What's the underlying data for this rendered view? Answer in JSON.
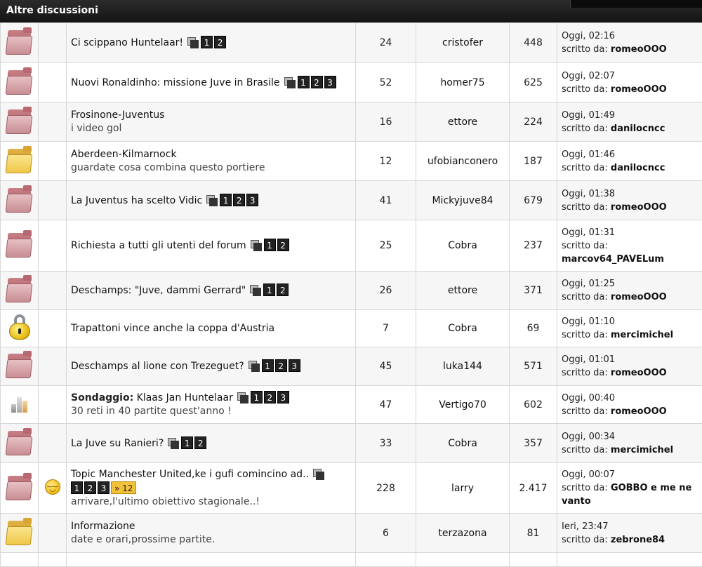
{
  "section": {
    "title": "Altre discussioni"
  },
  "labels": {
    "written_by": "scritto da:"
  },
  "colors": {
    "header_bg": "#1f1f1f",
    "hot_folder": "#c78e94",
    "new_folder": "#efc84a",
    "more_pages": "#f3c138"
  },
  "topics": [
    {
      "icon": "hot-folder-icon",
      "emoticon": "",
      "prefix": "",
      "title": "Ci scippano Huntelaar!",
      "subtitle": "",
      "pages": [
        "1",
        "2"
      ],
      "more": "",
      "replies": "24",
      "author": "cristofer",
      "views": "448",
      "last_time": "Oggi, 02:16",
      "last_user": "romeoOOO"
    },
    {
      "icon": "hot-folder-icon",
      "emoticon": "",
      "prefix": "",
      "title": "Nuovi Ronaldinho: missione Juve in Brasile",
      "subtitle": "",
      "pages": [
        "1",
        "2",
        "3"
      ],
      "more": "",
      "replies": "52",
      "author": "homer75",
      "views": "625",
      "last_time": "Oggi, 02:07",
      "last_user": "romeoOOO"
    },
    {
      "icon": "hot-folder-icon",
      "emoticon": "",
      "prefix": "",
      "title": "Frosinone-Juventus",
      "subtitle": "i video gol",
      "pages": [],
      "more": "",
      "replies": "16",
      "author": "ettore",
      "views": "224",
      "last_time": "Oggi, 01:49",
      "last_user": "danilocncc"
    },
    {
      "icon": "new-folder-icon",
      "emoticon": "",
      "prefix": "",
      "title": "Aberdeen-Kilmarnock",
      "subtitle": "guardate cosa combina questo portiere",
      "pages": [],
      "more": "",
      "replies": "12",
      "author": "ufobianconero",
      "views": "187",
      "last_time": "Oggi, 01:46",
      "last_user": "danilocncc"
    },
    {
      "icon": "hot-folder-icon",
      "emoticon": "",
      "prefix": "",
      "title": "La Juventus ha scelto Vidic",
      "subtitle": "",
      "pages": [
        "1",
        "2",
        "3"
      ],
      "more": "",
      "replies": "41",
      "author": "Mickyjuve84",
      "views": "679",
      "last_time": "Oggi, 01:38",
      "last_user": "romeoOOO"
    },
    {
      "icon": "hot-folder-icon",
      "emoticon": "",
      "prefix": "",
      "title": "Richiesta a tutti gli utenti del forum",
      "subtitle": "",
      "pages": [
        "1",
        "2"
      ],
      "more": "",
      "replies": "25",
      "author": "Cobra",
      "views": "237",
      "last_time": "Oggi, 01:31",
      "last_user": "marcov64_PAVELum"
    },
    {
      "icon": "hot-folder-icon",
      "emoticon": "",
      "prefix": "",
      "title": "Deschamps: \"Juve, dammi Gerrard\"",
      "subtitle": "",
      "pages": [
        "1",
        "2"
      ],
      "more": "",
      "replies": "26",
      "author": "ettore",
      "views": "371",
      "last_time": "Oggi, 01:25",
      "last_user": "romeoOOO"
    },
    {
      "icon": "lock-icon",
      "emoticon": "",
      "prefix": "",
      "title": "Trapattoni vince anche la coppa d'Austria",
      "subtitle": "",
      "pages": [],
      "more": "",
      "replies": "7",
      "author": "Cobra",
      "views": "69",
      "last_time": "Oggi, 01:10",
      "last_user": "mercimichel"
    },
    {
      "icon": "hot-folder-icon",
      "emoticon": "",
      "prefix": "",
      "title": "Deschamps al lione con Trezeguet?",
      "subtitle": "",
      "pages": [
        "1",
        "2",
        "3"
      ],
      "more": "",
      "replies": "45",
      "author": "luka144",
      "views": "571",
      "last_time": "Oggi, 01:01",
      "last_user": "romeoOOO"
    },
    {
      "icon": "poll-icon",
      "emoticon": "",
      "prefix": "Sondaggio:",
      "title": "Klaas Jan Huntelaar",
      "subtitle": "30 reti in 40 partite quest'anno !",
      "pages": [
        "1",
        "2",
        "3"
      ],
      "more": "",
      "replies": "47",
      "author": "Vertigo70",
      "views": "602",
      "last_time": "Oggi, 00:40",
      "last_user": "romeoOOO"
    },
    {
      "icon": "hot-folder-icon",
      "emoticon": "",
      "prefix": "",
      "title": "La Juve su Ranieri?",
      "subtitle": "",
      "pages": [
        "1",
        "2"
      ],
      "more": "",
      "replies": "33",
      "author": "Cobra",
      "views": "357",
      "last_time": "Oggi, 00:34",
      "last_user": "mercimichel"
    },
    {
      "icon": "hot-folder-icon",
      "emoticon": "smiley-icon",
      "prefix": "",
      "title": "Topic Manchester United,ke i gufi comincino ad..",
      "subtitle": "arrivare,l'ultimo obiettivo stagionale..!",
      "pages": [
        "1",
        "2",
        "3"
      ],
      "more": "» 12",
      "replies": "228",
      "author": "larry",
      "views": "2.417",
      "last_time": "Oggi, 00:07",
      "last_user": "GOBBO e me ne vanto"
    },
    {
      "icon": "new-folder-icon",
      "emoticon": "",
      "prefix": "",
      "title": "Informazione",
      "subtitle": "date e orari,prossime partite.",
      "pages": [],
      "more": "",
      "replies": "6",
      "author": "terzazona",
      "views": "81",
      "last_time": "Ieri, 23:47",
      "last_user": "zebrone84"
    }
  ]
}
